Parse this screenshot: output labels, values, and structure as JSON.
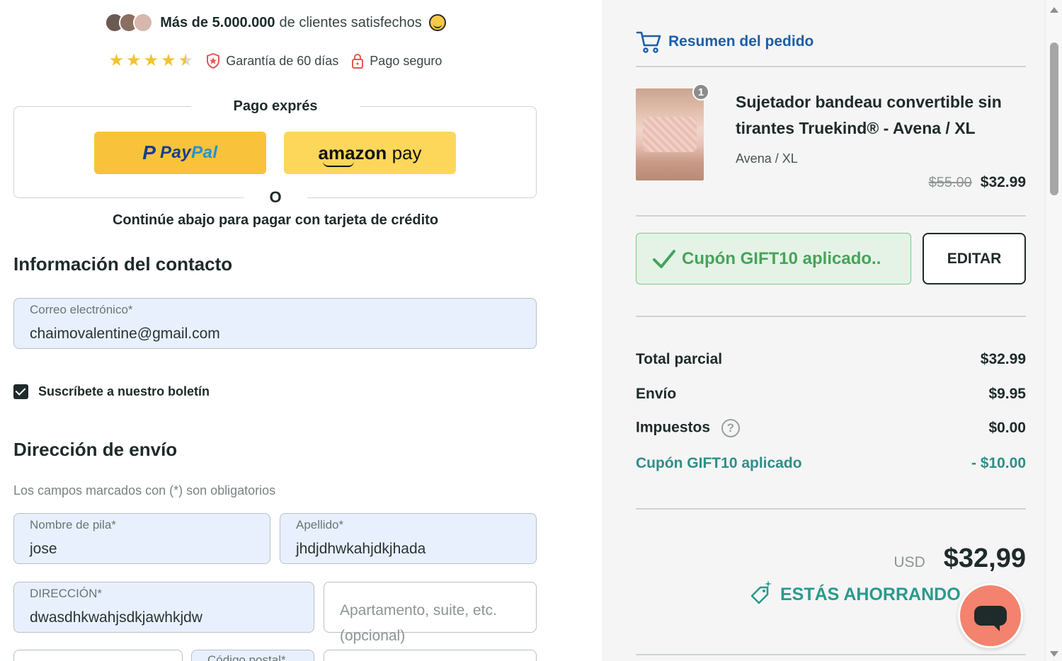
{
  "trust": {
    "strong": "Más de 5.000.000",
    "rest": "de clientes satisfechos",
    "rating_stars": 4.5,
    "guarantee": "Garantía de 60 días",
    "secure": "Pago seguro"
  },
  "express": {
    "title": "Pago exprés",
    "paypal_label_1": "Pay",
    "paypal_label_2": "Pal",
    "amazon_label_1": "amazon",
    "amazon_label_2": "pay",
    "or": "O",
    "continue": "Continúe abajo para pagar con tarjeta de crédito"
  },
  "contact": {
    "title": "Información del contacto",
    "email_label": "Correo electrónico*",
    "email_value": "chaimovalentine@gmail.com",
    "newsletter_label": "Suscríbete a nuestro boletín",
    "newsletter_checked": true
  },
  "shipping": {
    "title": "Dirección de envío",
    "required_note": "Los campos marcados con (*) son obligatorios",
    "first_name_label": "Nombre de pila*",
    "first_name_value": "jose",
    "last_name_label": "Apellido*",
    "last_name_value": "jhdjdhwkahjdkjhada",
    "address_label": "DIRECCIÓN*",
    "address_value": "dwasdhkwahjsdkjawhkjdw",
    "apartment_placeholder": "Apartamento, suite, etc. (opcional)",
    "postal_label": "Código postal*"
  },
  "summary": {
    "title": "Resumen del pedido",
    "product": {
      "quantity": "1",
      "name": "Sujetador bandeau convertible sin tirantes Truekind® - Avena / XL",
      "variant": "Avena / XL",
      "old_price": "$55.00",
      "price": "$32.99"
    },
    "coupon_text": "Cupón GIFT10 aplicado..",
    "edit_label": "EDITAR",
    "lines": {
      "subtotal_label": "Total parcial",
      "subtotal_value": "$32.99",
      "shipping_label": "Envío",
      "shipping_value": "$9.95",
      "taxes_label": "Impuestos",
      "taxes_help": "?",
      "taxes_value": "$0.00",
      "coupon_label": "Cupón GIFT10 aplicado",
      "coupon_value": "- $10.00"
    },
    "currency": "USD",
    "total": "$32,99",
    "saving_label": "ESTÁS AHORRANDO"
  },
  "colors": {
    "accent_blue": "#1c5fa8",
    "coupon_green": "#47a35a",
    "teal": "#2e8f88",
    "paypal_yellow": "#f8c33a",
    "chat_coral": "#f3836e"
  }
}
